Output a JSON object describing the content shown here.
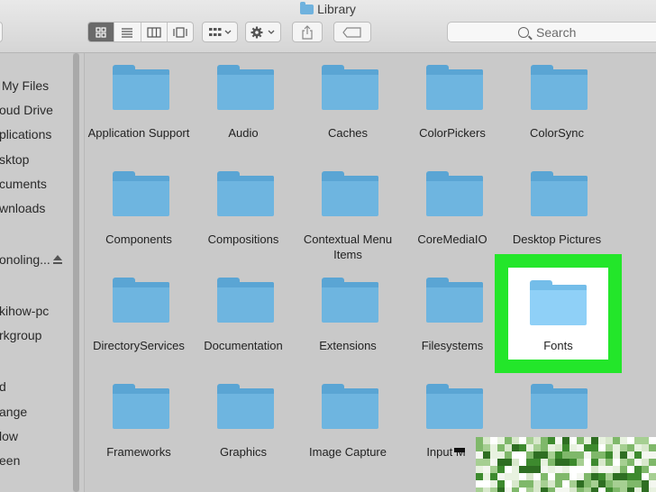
{
  "window": {
    "title": "Library"
  },
  "toolbar": {
    "view_buttons": [
      "icon-view",
      "list-view",
      "column-view",
      "gallery-view"
    ],
    "search_placeholder": "Search"
  },
  "sidebar": {
    "items": [
      {
        "label": "My Files"
      },
      {
        "label": "oud Drive"
      },
      {
        "label": "plications"
      },
      {
        "label": "sktop"
      },
      {
        "label": "cuments"
      },
      {
        "label": "wnloads"
      },
      {
        "label": "onoling..."
      },
      {
        "label": "kihow-pc"
      },
      {
        "label": "rkgroup"
      },
      {
        "label": "d"
      },
      {
        "label": "ange"
      },
      {
        "label": "low"
      },
      {
        "label": "een"
      }
    ]
  },
  "folders": [
    {
      "label": "Application Support"
    },
    {
      "label": "Audio"
    },
    {
      "label": "Caches"
    },
    {
      "label": "ColorPickers"
    },
    {
      "label": "ColorSync"
    },
    {
      "label": "Components"
    },
    {
      "label": "Compositions"
    },
    {
      "label": "Contextual Menu Items"
    },
    {
      "label": "CoreMediaIO"
    },
    {
      "label": "Desktop Pictures"
    },
    {
      "label": "DirectoryServices"
    },
    {
      "label": "Documentation"
    },
    {
      "label": "Extensions"
    },
    {
      "label": "Filesystems"
    },
    {
      "label": "Fonts",
      "highlighted": true
    },
    {
      "label": "Frameworks"
    },
    {
      "label": "Graphics"
    },
    {
      "label": "Image Capture"
    },
    {
      "label": "Input M"
    },
    {
      "label": ""
    }
  ],
  "colors": {
    "folder": "#6eb5e0",
    "highlight": "#23e62a",
    "selected_folder": "#8fd0f7"
  }
}
